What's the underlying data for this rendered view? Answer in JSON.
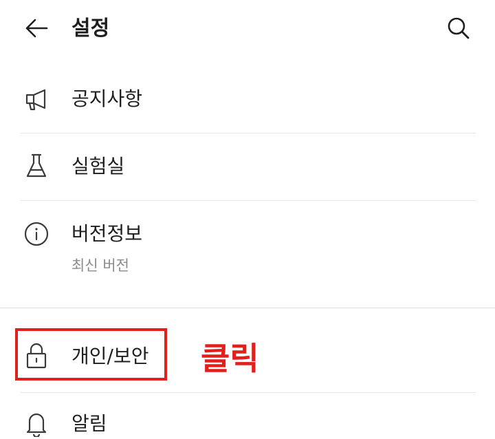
{
  "header": {
    "title": "설정",
    "back_icon": "arrow-left-icon",
    "search_icon": "search-icon"
  },
  "menu": {
    "items": [
      {
        "label": "공지사항",
        "icon": "megaphone-icon"
      },
      {
        "label": "실험실",
        "icon": "flask-icon"
      },
      {
        "label": "버전정보",
        "sub": "최신 버전",
        "icon": "info-icon"
      },
      {
        "label": "개인/보안",
        "icon": "lock-icon"
      },
      {
        "label": "알림",
        "icon": "bell-icon"
      }
    ]
  },
  "annotation": {
    "text": "클릭",
    "color": "#e0201c"
  }
}
